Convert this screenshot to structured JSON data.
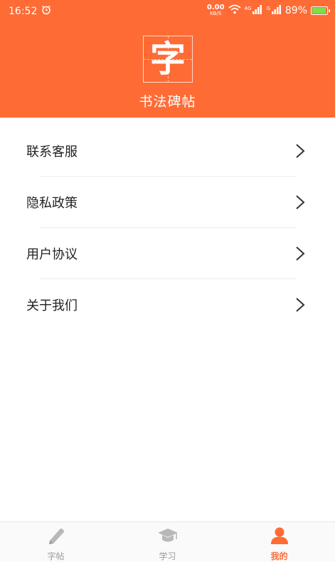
{
  "status_bar": {
    "time": "16:52",
    "net_speed": "0.00",
    "net_unit": "KB/S",
    "signal_1_tag": "4G",
    "signal_2_tag": "G",
    "battery": "89%"
  },
  "header": {
    "logo_char": "字",
    "title": "书法碑帖"
  },
  "menu": {
    "items": [
      {
        "label": "联系客服"
      },
      {
        "label": "隐私政策"
      },
      {
        "label": "用户协议"
      },
      {
        "label": "关于我们"
      }
    ]
  },
  "tabbar": {
    "tabs": [
      {
        "label": "字帖",
        "icon": "pen-icon"
      },
      {
        "label": "学习",
        "icon": "graduation-cap-icon"
      },
      {
        "label": "我的",
        "icon": "user-icon",
        "active": true
      }
    ]
  },
  "colors": {
    "accent": "#ff6b35",
    "inactive": "#b0b0b0"
  }
}
